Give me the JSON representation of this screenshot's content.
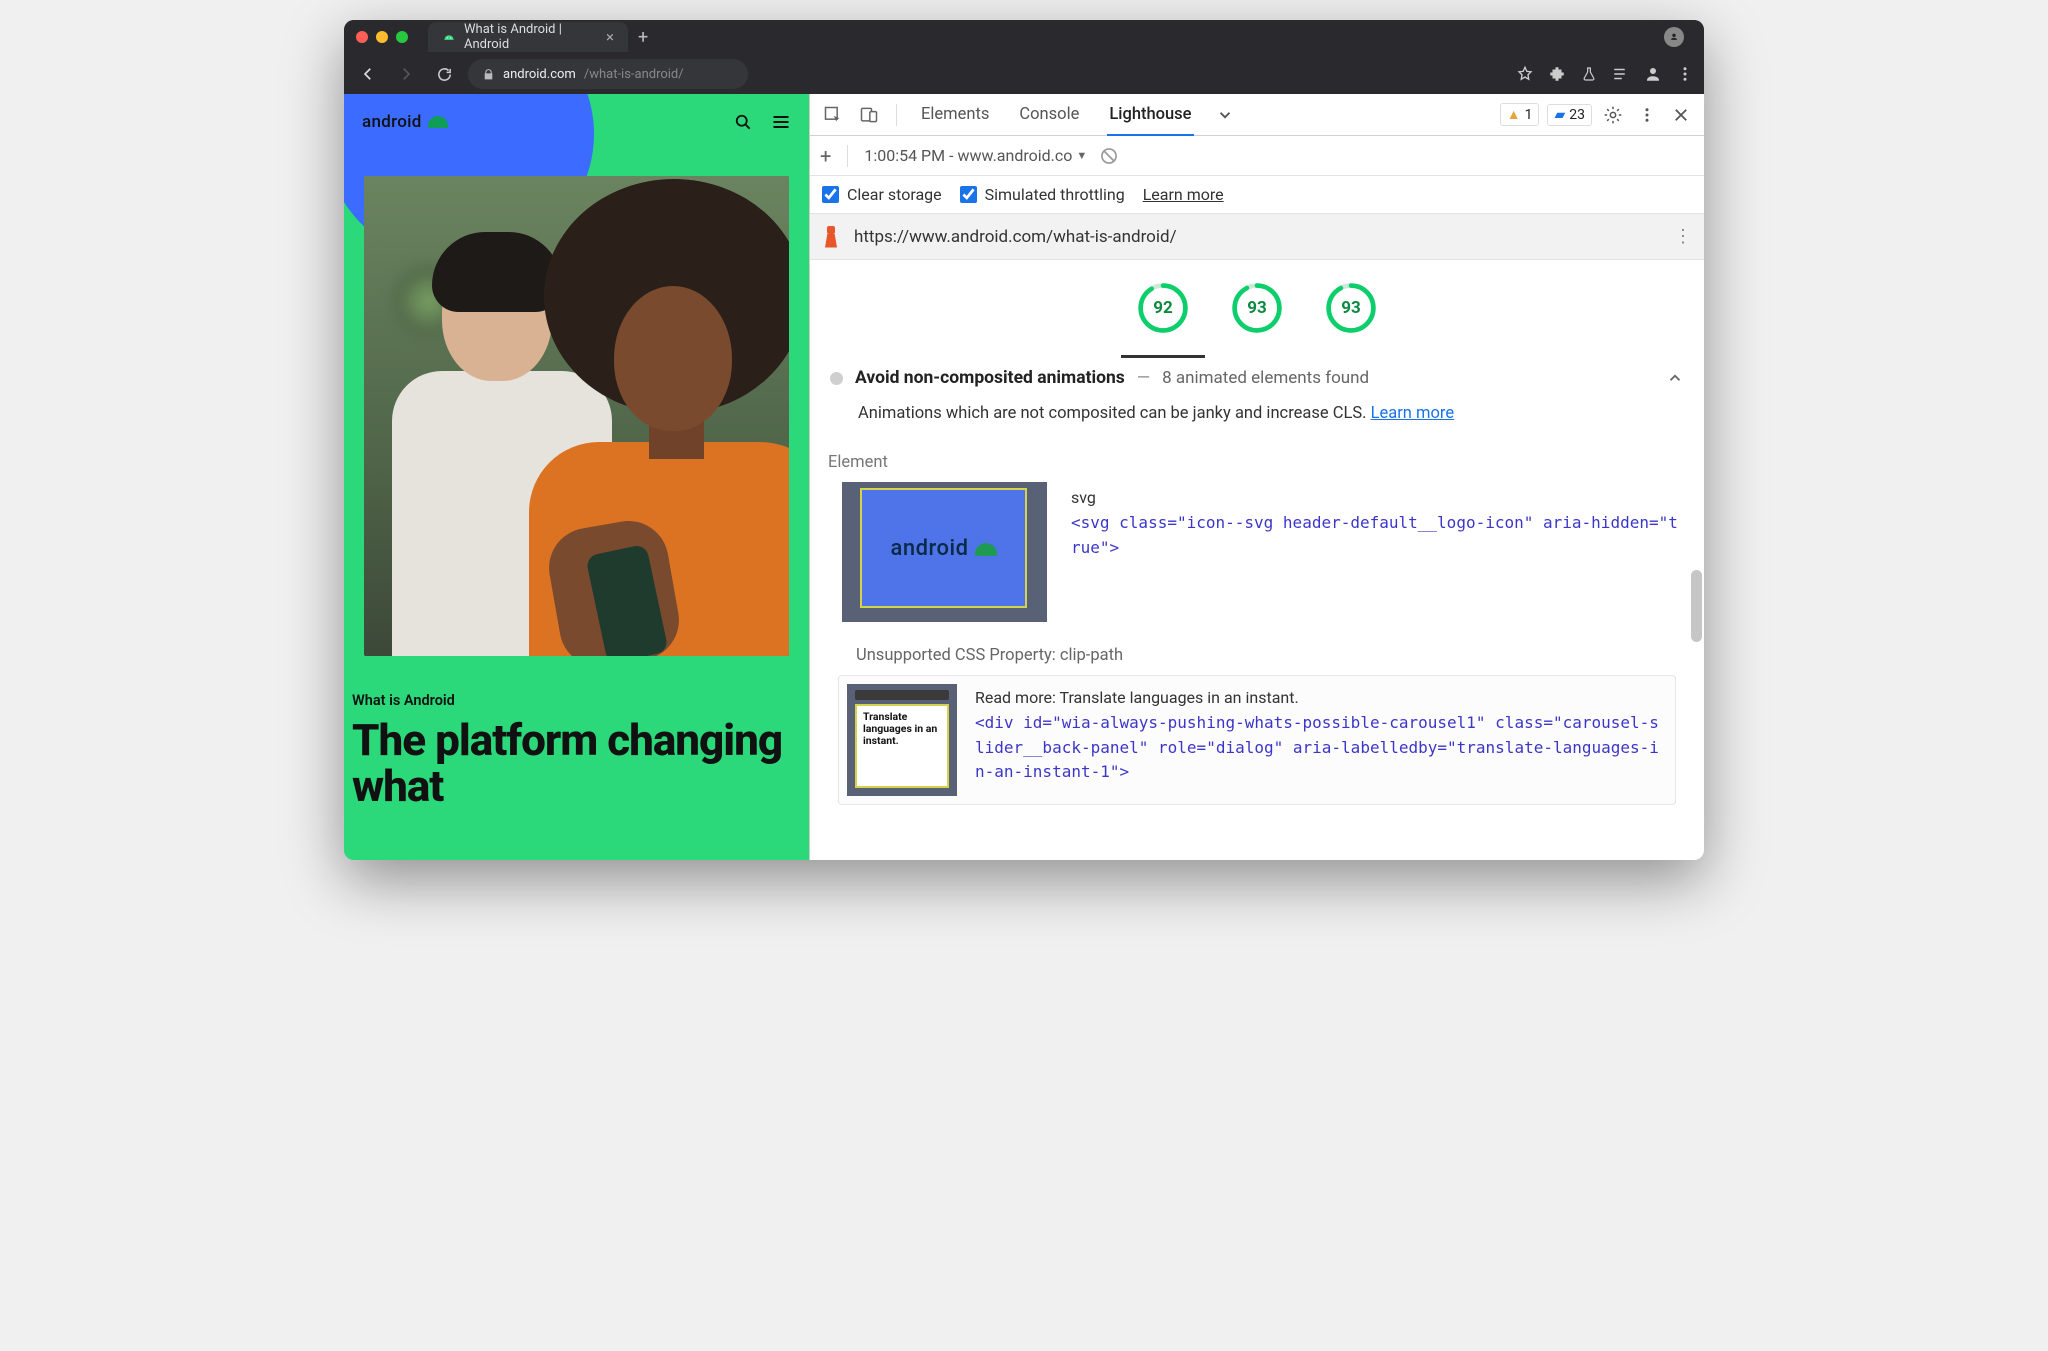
{
  "browser": {
    "tab_title": "What is Android | Android",
    "url_host": "android.com",
    "url_path": "/what-is-android/"
  },
  "page": {
    "brand": "android",
    "eyebrow": "What is Android",
    "headline": "The platform changing what"
  },
  "devtools": {
    "tabs": [
      "Elements",
      "Console",
      "Lighthouse"
    ],
    "active_tab": "Lighthouse",
    "warn_count": "1",
    "info_count": "23",
    "report_label": "1:00:54 PM - www.android.co",
    "clear_storage": "Clear storage",
    "sim_throttle": "Simulated throttling",
    "learn_more": "Learn more",
    "url": "https://www.android.com/what-is-android/",
    "scores": [
      "92",
      "93",
      "93"
    ],
    "audit": {
      "title": "Avoid non-composited animations",
      "dash": "—",
      "summary": "8 animated elements found",
      "desc_a": "Animations which are not composited can be janky and increase CLS. ",
      "learn_more": "Learn more",
      "element_label": "Element",
      "el1_tag": "svg",
      "el1_code": "<svg class=\"icon--svg header-default__logo-icon\" aria-hidden=\"true\">",
      "el1_thumb_text": "android",
      "sub_label": "Unsupported CSS Property: clip-path",
      "el2_read": "Read more: Translate languages in an instant.",
      "el2_code": "<div id=\"wia-always-pushing-whats-possible-carousel1\" class=\"carousel-slider__back-panel\" role=\"dialog\" aria-labelledby=\"translate-languages-in-an-instant-1\">",
      "el2_t1": "Translate",
      "el2_t2": "languages in an",
      "el2_t3": "instant."
    }
  }
}
